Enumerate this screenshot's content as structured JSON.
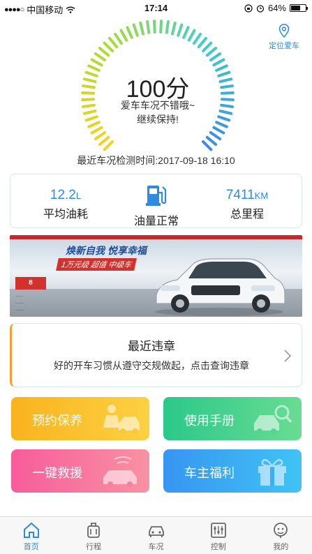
{
  "status_bar": {
    "carrier": "中国移动",
    "time": "17:14",
    "battery": "64%",
    "battery_level": 0.64
  },
  "header": {
    "locate_label": "定位爱车"
  },
  "health": {
    "score": "100分",
    "message_line1": "爱车车况不错哦~",
    "message_line2": "继续保持!",
    "score_fraction": 1.0
  },
  "check_time": "最近车况检测时间:2017-09-18 16:10",
  "stats": {
    "fuel_consumption": {
      "value": "12.2",
      "unit": "L",
      "label": "平均油耗"
    },
    "fuel_status": {
      "label": "油量正常",
      "icon": "fuel-pump-icon"
    },
    "mileage": {
      "value": "7411",
      "unit": "KM",
      "label": "总里程"
    }
  },
  "banner": {
    "slogan": "焕新自我  悦享幸福",
    "promo": "1万元级 超值 中级车",
    "side_tag": "8",
    "lines": [
      "......",
      "......",
      "......"
    ]
  },
  "violation": {
    "title": "最近违章",
    "description": "好的开车习惯从遵守交规做起，点击查询违章"
  },
  "tiles": [
    {
      "label": "预约保养",
      "icon": "car-maintenance-icon",
      "color": "#f9b31e"
    },
    {
      "label": "使用手册",
      "icon": "car-search-icon",
      "color": "#2bc88a"
    },
    {
      "label": "一键救援",
      "icon": "sos-car-icon",
      "color": "#f75c9b"
    },
    {
      "label": "车主福利",
      "icon": "gift-icon",
      "color": "#3795f1"
    }
  ],
  "tabbar": [
    {
      "label": "首页",
      "icon": "home-icon",
      "active": true
    },
    {
      "label": "行程",
      "icon": "luggage-icon",
      "active": false
    },
    {
      "label": "车况",
      "icon": "car-icon",
      "active": false
    },
    {
      "label": "控制",
      "icon": "sliders-icon",
      "active": false
    },
    {
      "label": "我的",
      "icon": "face-icon",
      "active": false
    }
  ],
  "colors": {
    "accent": "#2f8be0",
    "violation_accent": "#f5a030"
  }
}
